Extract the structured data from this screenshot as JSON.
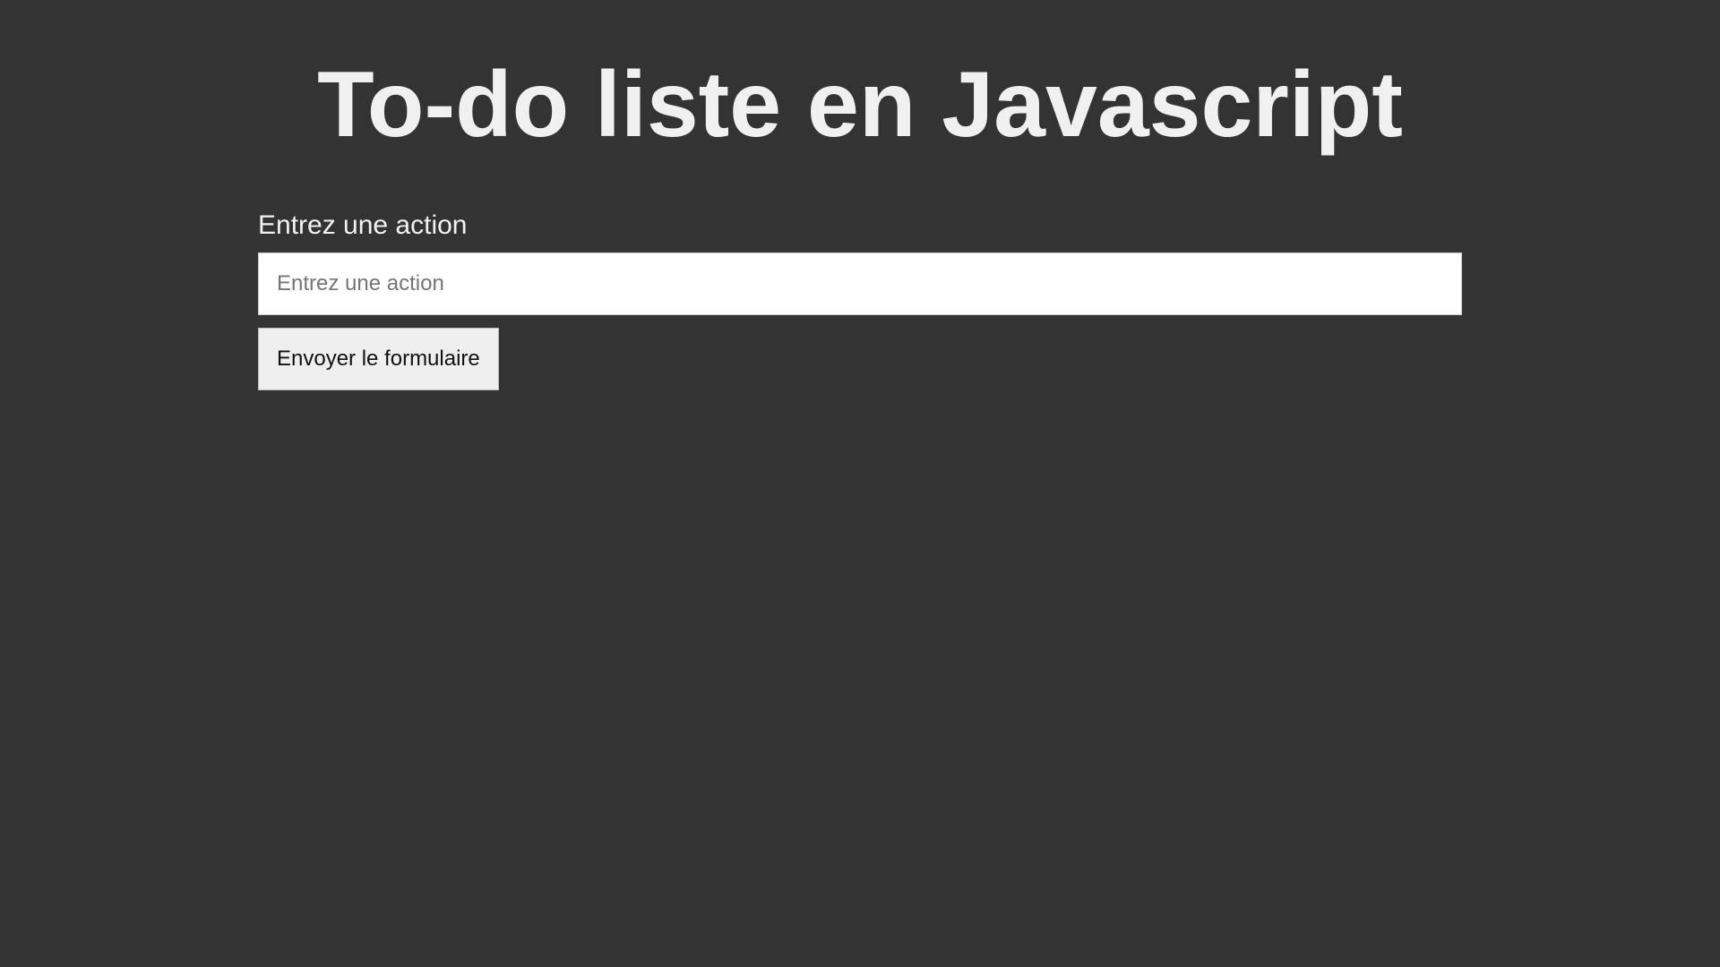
{
  "page": {
    "title": "To-do liste en Javascript"
  },
  "form": {
    "label": "Entrez une action",
    "input_placeholder": "Entrez une action",
    "input_value": "",
    "submit_label": "Envoyer le formulaire"
  },
  "colors": {
    "background": "#333333",
    "title_text": "#f0f0f0",
    "input_background": "#ffffff",
    "button_background": "#efefef"
  }
}
